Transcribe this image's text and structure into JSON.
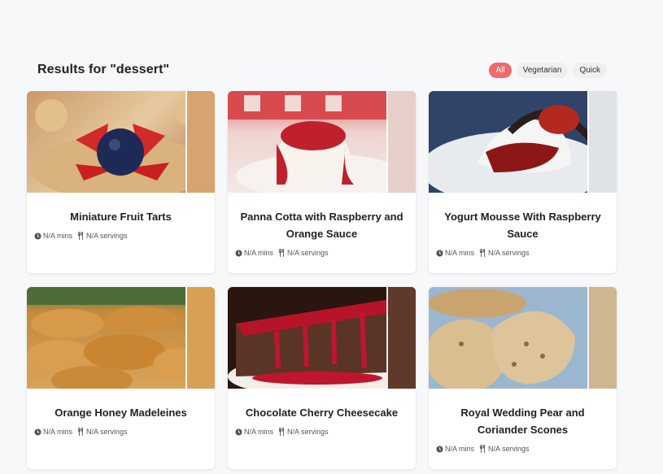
{
  "search": {
    "heading": "Results for \"dessert\"",
    "filters": [
      {
        "label": "All",
        "active": true
      },
      {
        "label": "Vegetarian",
        "active": false
      },
      {
        "label": "Quick",
        "active": false
      }
    ]
  },
  "recipes": [
    {
      "title": "Miniature Fruit Tarts",
      "time": "N/A mins",
      "servings": "N/A servings"
    },
    {
      "title": "Panna Cotta with Raspberry and Orange Sauce",
      "time": "N/A mins",
      "servings": "N/A servings"
    },
    {
      "title": "Yogurt Mousse With Raspberry Sauce",
      "time": "N/A mins",
      "servings": "N/A servings"
    },
    {
      "title": "Orange Honey Madeleines",
      "time": "N/A mins",
      "servings": "N/A servings"
    },
    {
      "title": "Chocolate Cherry Cheesecake",
      "time": "N/A mins",
      "servings": "N/A servings"
    },
    {
      "title": "Royal Wedding Pear and Coriander Scones",
      "time": "N/A mins",
      "servings": "N/A servings"
    }
  ],
  "colors": {
    "accent": "#f06a6a",
    "background": "#f7f8fa",
    "card": "#ffffff"
  },
  "icons": {
    "time": "clock-icon",
    "servings": "utensils-icon"
  }
}
